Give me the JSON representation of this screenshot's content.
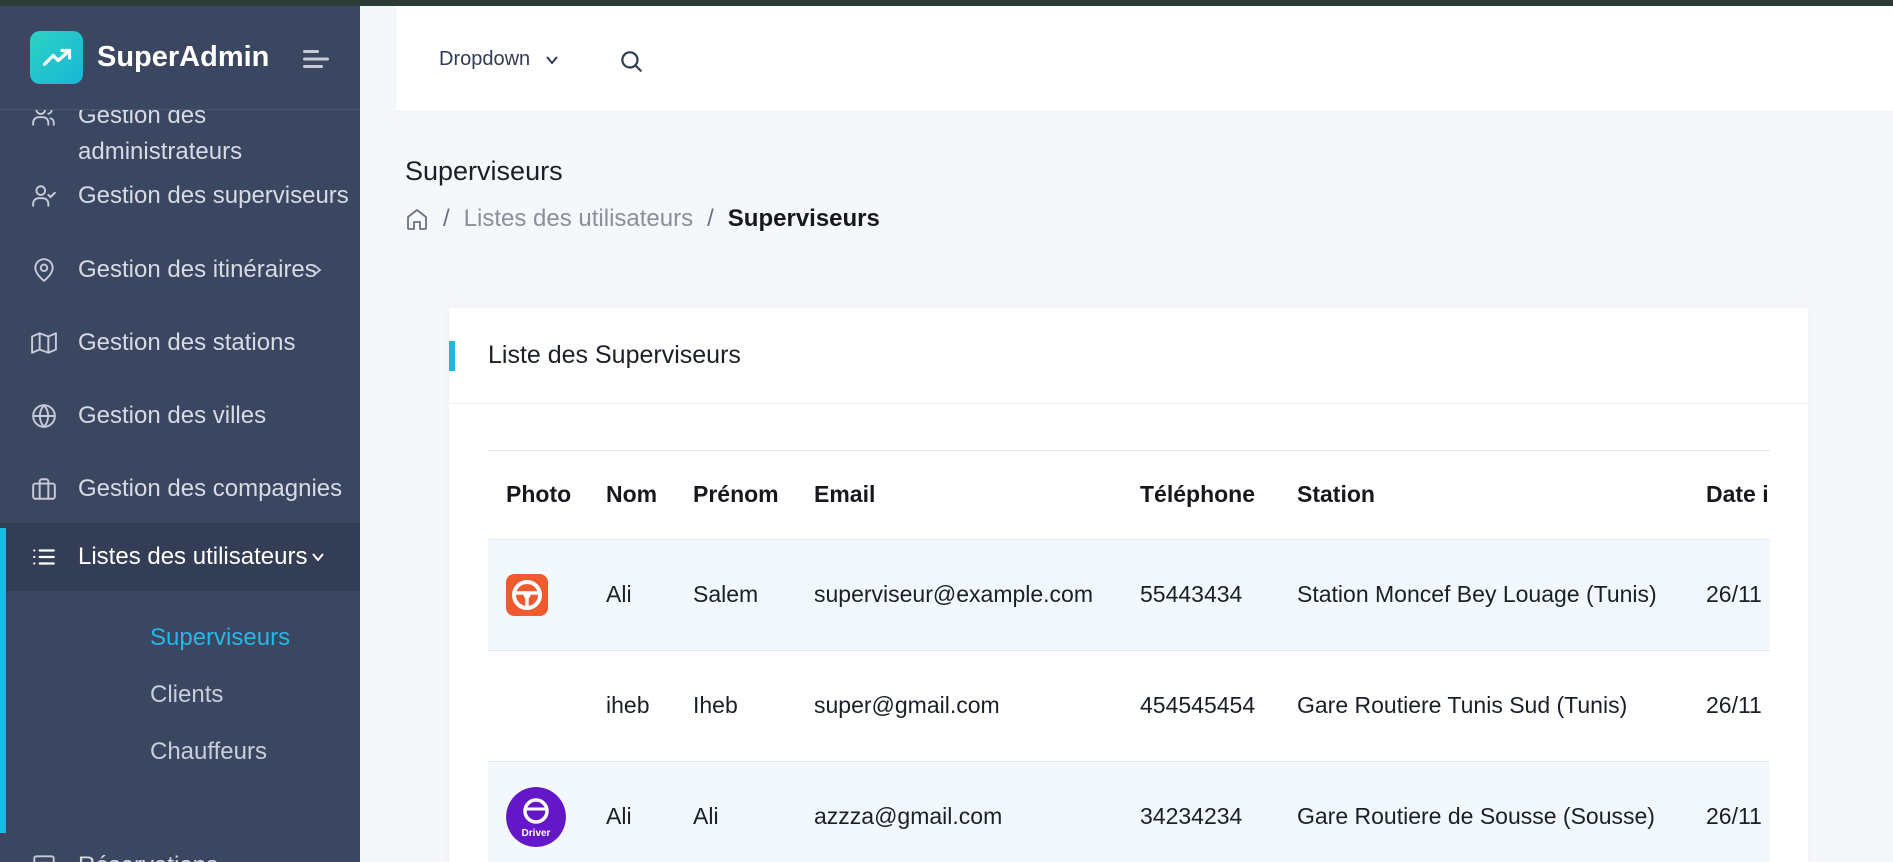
{
  "brand": {
    "name": "SuperAdmin"
  },
  "sidebar": {
    "items": [
      {
        "label_line1": "Gestion des",
        "label_line2": "administrateurs",
        "icon": "users-icon"
      },
      {
        "label": "Gestion des superviseurs",
        "icon": "user-check-icon"
      },
      {
        "label": "Gestion des itinéraires",
        "icon": "map-pin-icon"
      },
      {
        "label": "Gestion des stations",
        "icon": "map-icon"
      },
      {
        "label": "Gestion des villes",
        "icon": "globe-icon"
      },
      {
        "label": "Gestion des compagnies",
        "icon": "briefcase-icon"
      },
      {
        "label": "Listes des utilisateurs",
        "icon": "list-icon"
      }
    ],
    "subitems": [
      "Superviseurs",
      "Clients",
      "Chauffeurs"
    ],
    "clipped_item": "Réservations"
  },
  "header": {
    "dropdown_label": "Dropdown"
  },
  "page": {
    "title": "Superviseurs",
    "breadcrumb": [
      "Listes des utilisateurs",
      "Superviseurs"
    ]
  },
  "card": {
    "title": "Liste des Superviseurs",
    "columns": [
      "Photo",
      "Nom",
      "Prénom",
      "Email",
      "Téléphone",
      "Station",
      "Date inscription"
    ],
    "rows": [
      {
        "photo": "steering-wheel-app-icon",
        "nom": "Ali",
        "prenom": "Salem",
        "email": "superviseur@example.com",
        "telephone": "55443434",
        "station": "Station Moncef Bey Louage (Tunis)",
        "date": "26/11"
      },
      {
        "photo": "",
        "nom": "iheb",
        "prenom": "Iheb",
        "email": "super@gmail.com",
        "telephone": "454545454",
        "station": "Gare Routiere Tunis Sud (Tunis)",
        "date": "26/11"
      },
      {
        "photo": "driver-logo-icon",
        "photo_text": "Driver",
        "nom": "Ali",
        "prenom": "Ali",
        "email": "azzza@gmail.com",
        "telephone": "34234234",
        "station": "Gare Routiere de Sousse (Sousse)",
        "date": "26/11"
      }
    ]
  },
  "colors": {
    "sidebar": "#3b4660",
    "accent": "#1fb8e3",
    "active_sub": "#29b6e6"
  }
}
